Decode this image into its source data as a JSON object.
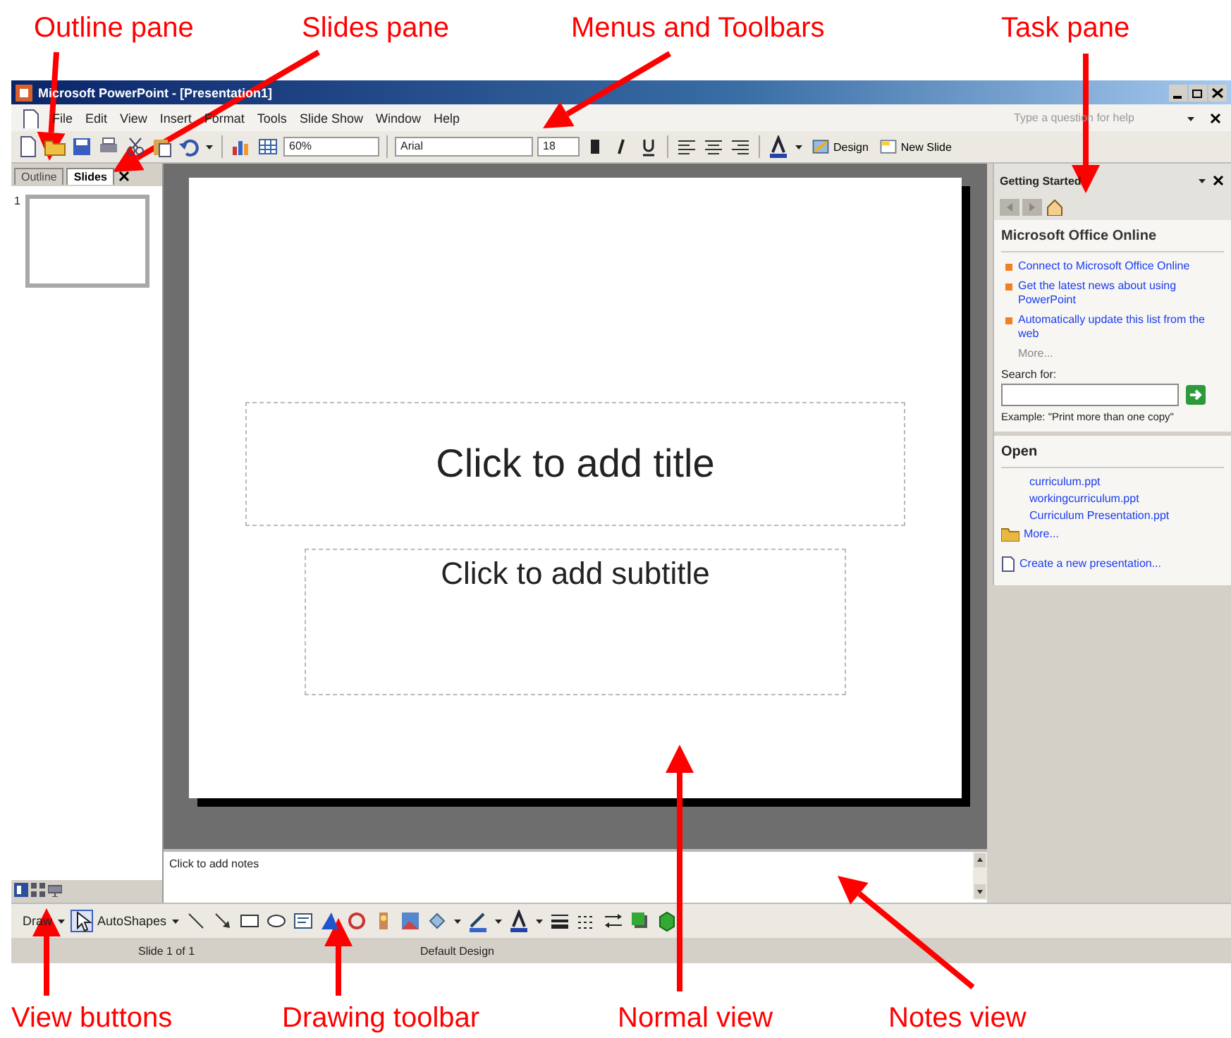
{
  "window": {
    "title": "Microsoft PowerPoint - [Presentation1]"
  },
  "menu": [
    "File",
    "Edit",
    "View",
    "Insert",
    "Format",
    "Tools",
    "Slide Show",
    "Window",
    "Help"
  ],
  "help_box": {
    "placeholder": "Type a question for help"
  },
  "toolbar": {
    "zoom": "60%",
    "font": "Arial",
    "font_size": "18",
    "buttons": [
      "Design",
      "New Slide"
    ]
  },
  "slides_pane": {
    "tabs": [
      {
        "label": "Outline",
        "selected": false
      },
      {
        "label": "Slides",
        "selected": true
      }
    ],
    "thumbnails": [
      {
        "number": "1",
        "selected": true
      }
    ]
  },
  "slide": {
    "title": "Click to add title",
    "subtitle": "Click to add subtitle"
  },
  "notes": {
    "placeholder": "Click to add notes"
  },
  "task_pane": {
    "title": "Getting Started",
    "online": {
      "heading": "Microsoft Office Online",
      "links": [
        "Connect to Microsoft Office Online",
        "Get the latest news about using PowerPoint",
        "Automatically update this list from the web"
      ],
      "more": "More...",
      "search_label": "Search for:",
      "example": "Example:  \"Print more than one copy\""
    },
    "open": {
      "heading": "Open",
      "files": [
        "curriculum.ppt",
        "workingcurriculum.ppt",
        "Curriculum Presentation.ppt"
      ],
      "more": "More...",
      "create": "Create a new presentation..."
    }
  },
  "drawing_toolbar": {
    "draw": "Draw",
    "autoshapes": "AutoShapes"
  },
  "status_bar": [
    "Slide 1 of 1",
    "Default Design"
  ],
  "annotations": {
    "top": [
      "Outline pane",
      "Slides pane",
      "Menus and Toolbars",
      "Task pane"
    ],
    "bottom": [
      "View buttons",
      "Drawing toolbar",
      "Normal view",
      "Notes view"
    ]
  }
}
